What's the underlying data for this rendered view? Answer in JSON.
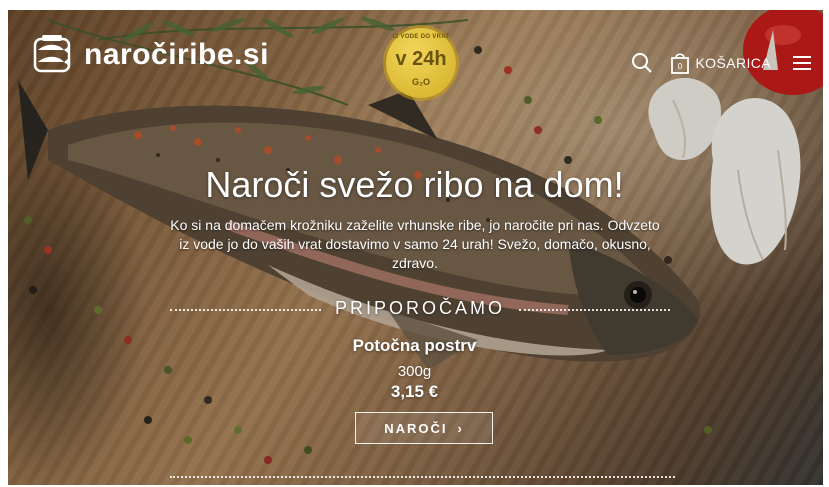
{
  "header": {
    "logo_text": "naroč​iribe.si",
    "cart_label": "KOŠARICA",
    "cart_count": "0"
  },
  "badge": {
    "top": "IZ VODE DO VRAT",
    "main": "v 24h",
    "bottom": "G₂O"
  },
  "hero": {
    "headline": "Naroči svežo ribo na dom!",
    "subtitle": "Ko si na domačem krožniku zaželite vrhunske ribe, jo naročite pri nas. Odvzeto iz vode jo do vaših vrat dostavimo v samo 24 urah! Svežo, domačo, okusno, zdravo."
  },
  "recommendation": {
    "section_title": "PRIPOROČAMO",
    "product_name": "Potočna postrv",
    "weight": "300g",
    "price": "3,15 €",
    "button_label": "NAROČI",
    "button_arrow": "›"
  },
  "colors": {
    "badge_gold": "#d9b52b",
    "text": "#ffffff"
  },
  "icons": [
    "fish-logo-icon",
    "search-icon",
    "shopping-bag-icon",
    "hamburger-menu-icon",
    "chevron-right-icon"
  ]
}
